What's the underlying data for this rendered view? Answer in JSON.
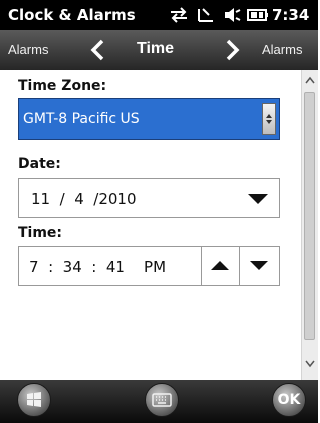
{
  "status_bar": {
    "app_title": "Clock & Alarms",
    "time": "7:34",
    "icons": [
      "connectivity-icon",
      "signal-icon",
      "volume-icon",
      "battery-icon"
    ]
  },
  "nav": {
    "left_label": "Alarms",
    "title": "Time",
    "right_label": "Alarms"
  },
  "form": {
    "timezone_label": "Time Zone:",
    "timezone_value": "GMT-8 Pacific US",
    "date_label": "Date:",
    "date_value": "11  /  4  /2010",
    "time_label": "Time:",
    "time_value": "7  :  34  :  41    PM"
  },
  "bottom_bar": {
    "ok_label": "OK",
    "icons": [
      "windows-start-icon",
      "keyboard-icon"
    ]
  },
  "colors": {
    "accent_selection": "#2b6fd0",
    "status_bar_bg": "#000000"
  }
}
